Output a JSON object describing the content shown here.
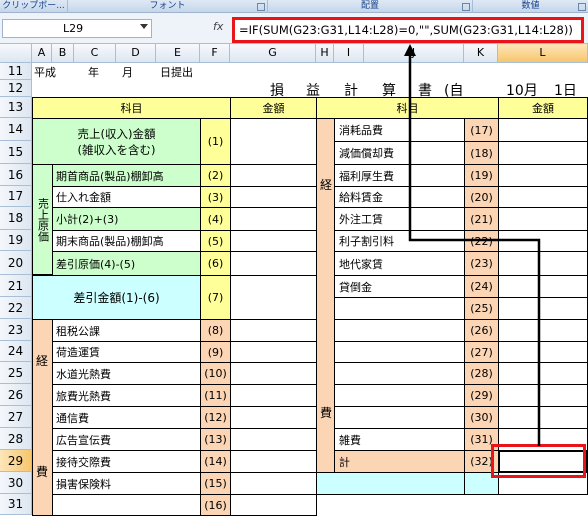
{
  "ribbon": {
    "groups": [
      "クリップボー...",
      "フォント",
      "配置",
      "数値"
    ]
  },
  "name_box": "L29",
  "fx": "fx",
  "formula": "=IF(SUM(G23:G31,L14:L28)=0,\"\",SUM(G23:G31,L14:L28))",
  "columns": [
    "A",
    "B",
    "C",
    "D",
    "E",
    "F",
    "G",
    "H",
    "I",
    "J",
    "K",
    "L"
  ],
  "rows": [
    "11",
    "12",
    "13",
    "14",
    "15",
    "16",
    "17",
    "18",
    "19",
    "20",
    "21",
    "22",
    "23",
    "24",
    "25",
    "26",
    "27",
    "28",
    "29",
    "30",
    "31"
  ],
  "r11": {
    "a": "平成",
    "c": "年",
    "d": "月",
    "e": "日提出"
  },
  "title_chars": [
    "損",
    "益",
    "計",
    "算",
    "書",
    "(自",
    "10月",
    "1日"
  ],
  "headers": {
    "kamoku": "科目",
    "kingaku": "金額"
  },
  "left_items": [
    {
      "label": "売上(収入)金額\n(雑収入を含む)",
      "num": "(1)"
    },
    {
      "label": "期首商品(製品)棚卸高",
      "num": "(2)"
    },
    {
      "label": "仕入れ金額",
      "num": "(3)"
    },
    {
      "label": "小計(2)+(3)",
      "num": "(4)"
    },
    {
      "label": "期末商品(製品)棚卸高",
      "num": "(5)"
    },
    {
      "label": "差引原価(4)-(5)",
      "num": "(6)"
    },
    {
      "label": "差引金額(1)-(6)",
      "num": "(7)"
    },
    {
      "label": "租税公課",
      "num": "(8)"
    },
    {
      "label": "荷造運賃",
      "num": "(9)"
    },
    {
      "label": "水道光熱費",
      "num": "(10)"
    },
    {
      "label": "旅費光熱費",
      "num": "(11)"
    },
    {
      "label": "通信費",
      "num": "(12)"
    },
    {
      "label": "広告宣伝費",
      "num": "(13)"
    },
    {
      "label": "接待交際費",
      "num": "(14)"
    },
    {
      "label": "損害保険料",
      "num": "(15)"
    },
    {
      "label": "",
      "num": "(16)"
    }
  ],
  "cost_label": "売上原価",
  "kei_left": "経",
  "hi_left": "費",
  "right_items": [
    {
      "label": "消耗品費",
      "num": "(17)"
    },
    {
      "label": "減価償却費",
      "num": "(18)"
    },
    {
      "label": "福利厚生費",
      "num": "(19)"
    },
    {
      "label": "給料賃金",
      "num": "(20)"
    },
    {
      "label": "外注工賃",
      "num": "(21)"
    },
    {
      "label": "利子割引料",
      "num": "(22)"
    },
    {
      "label": "地代家賃",
      "num": "(23)"
    },
    {
      "label": "貸倒金",
      "num": "(24)"
    },
    {
      "label": "",
      "num": "(25)"
    },
    {
      "label": "",
      "num": "(26)"
    },
    {
      "label": "",
      "num": "(27)"
    },
    {
      "label": "",
      "num": "(28)"
    },
    {
      "label": "",
      "num": "(29)"
    },
    {
      "label": "",
      "num": "(30)"
    },
    {
      "label": "雑費",
      "num": "(31)"
    },
    {
      "label": "計",
      "num": "(32)"
    }
  ],
  "kei_right": "経",
  "hi_right": "費"
}
